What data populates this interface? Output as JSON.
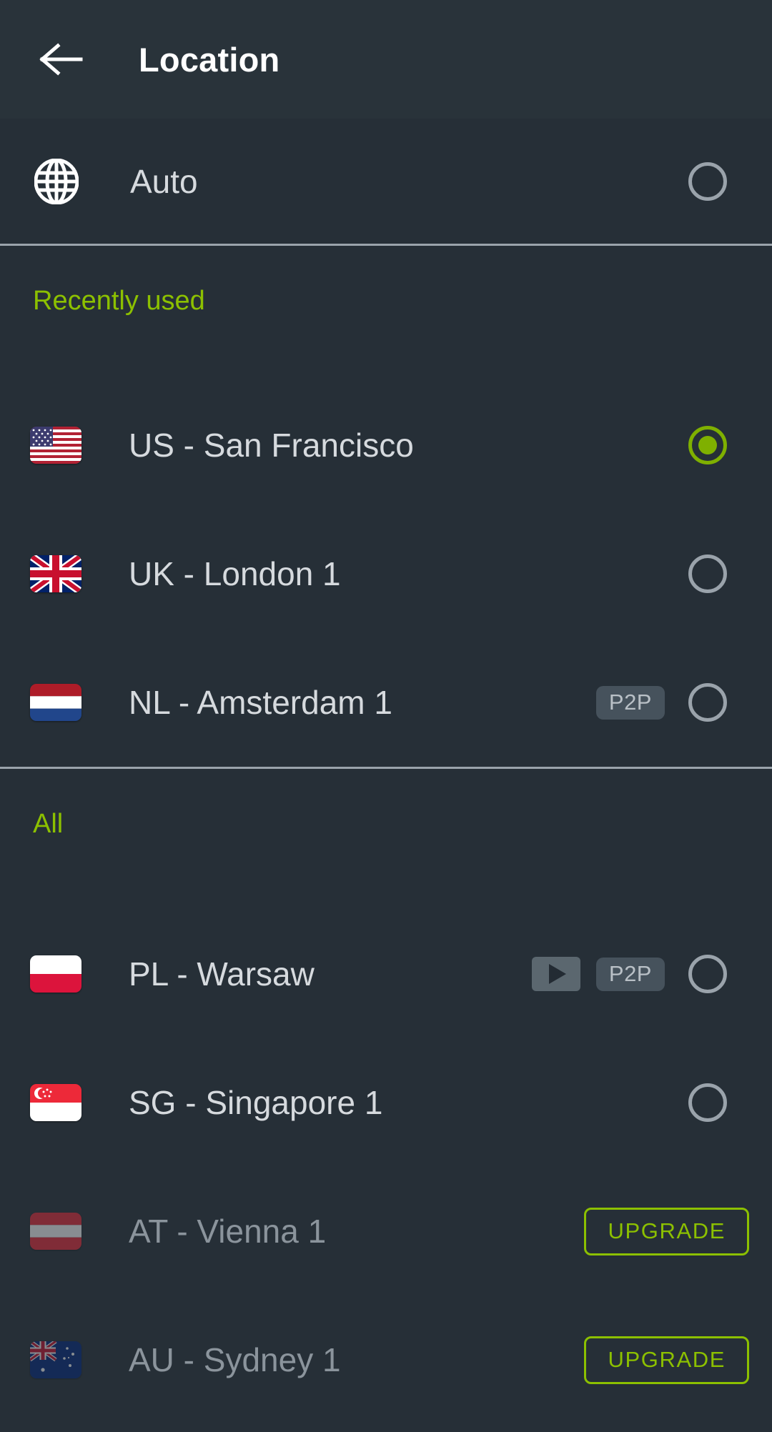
{
  "header": {
    "title": "Location",
    "back_icon": "arrow-left-icon"
  },
  "auto_row": {
    "label": "Auto",
    "icon": "globe-icon",
    "selected": false
  },
  "sections": [
    {
      "title": "Recently used",
      "items": [
        {
          "label": "US - San Francisco",
          "flag": "us-flag",
          "selected": true,
          "p2p": false,
          "stream": false,
          "locked": false
        },
        {
          "label": "UK - London 1",
          "flag": "uk-flag",
          "selected": false,
          "p2p": false,
          "stream": false,
          "locked": false
        },
        {
          "label": "NL - Amsterdam 1",
          "flag": "nl-flag",
          "selected": false,
          "p2p": true,
          "stream": false,
          "locked": false
        }
      ]
    },
    {
      "title": "All",
      "items": [
        {
          "label": "PL - Warsaw",
          "flag": "pl-flag",
          "selected": false,
          "p2p": true,
          "stream": true,
          "locked": false
        },
        {
          "label": "SG - Singapore 1",
          "flag": "sg-flag",
          "selected": false,
          "p2p": false,
          "stream": false,
          "locked": false
        },
        {
          "label": "AT - Vienna 1",
          "flag": "at-flag",
          "selected": false,
          "p2p": false,
          "stream": false,
          "locked": true
        },
        {
          "label": "AU - Sydney 1",
          "flag": "au-flag",
          "selected": false,
          "p2p": false,
          "stream": false,
          "locked": true
        }
      ]
    }
  ],
  "badges": {
    "p2p_label": "P2P",
    "upgrade_label": "UPGRADE",
    "stream_icon": "play-icon"
  },
  "colors": {
    "accent_green": "#8cc000",
    "radio_selected": "#7fb000",
    "header_bg": "#29333a",
    "body_bg": "#262f37",
    "text_primary": "#d6dade",
    "text_dimmed": "#8b949c",
    "badge_bg": "#46525c"
  }
}
